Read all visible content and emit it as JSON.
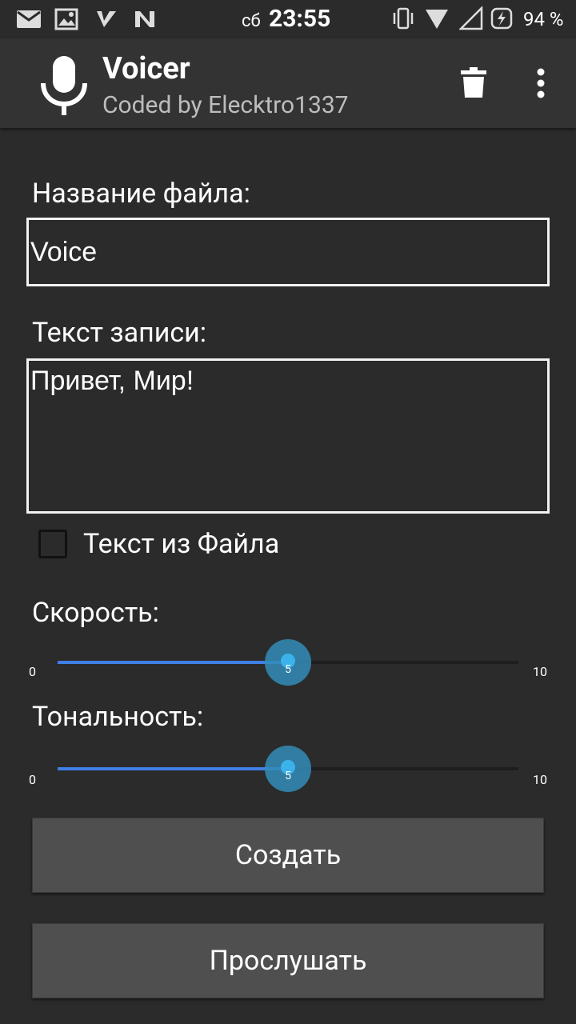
{
  "status_bar": {
    "day": "сб",
    "time": "23:55",
    "battery": "94 %",
    "icons": [
      "mail-icon",
      "image-icon",
      "check-flag-icon",
      "n-icon",
      "vibrate-icon",
      "wifi-icon",
      "signal-icon",
      "battery-charging-icon"
    ]
  },
  "app_bar": {
    "title": "Voicer",
    "subtitle": "Coded by Elecktro1337",
    "icons": [
      "microphone-icon",
      "trash-icon",
      "more-vert-icon"
    ]
  },
  "form": {
    "filename_label": "Название файла:",
    "filename_value": "Voice",
    "text_label": "Текст записи:",
    "text_value": "Привет, Мир!",
    "from_file_label": "Текст из Файла",
    "from_file_checked": false
  },
  "speed": {
    "label": "Скорость:",
    "min": "0",
    "max": "10",
    "value": "5"
  },
  "pitch": {
    "label": "Тональность:",
    "min": "0",
    "max": "10",
    "value": "5"
  },
  "buttons": {
    "create": "Создать",
    "listen": "Прослушать"
  },
  "colors": {
    "background": "#2b2b2b",
    "app_bar": "#333333",
    "accent": "#3f7fe6",
    "thumb": "#328cb9",
    "button": "#4f4f4f"
  }
}
